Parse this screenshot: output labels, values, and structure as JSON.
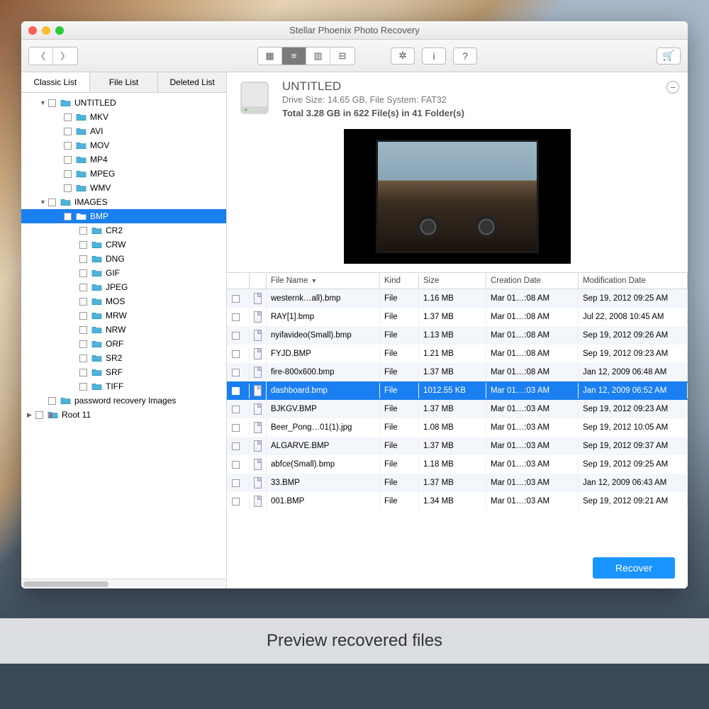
{
  "window": {
    "title": "Stellar Phoenix Photo Recovery"
  },
  "sideTabs": [
    "Classic List",
    "File List",
    "Deleted List"
  ],
  "tree": [
    {
      "level": 0,
      "label": "UNTITLED",
      "disclosure": "down",
      "kind": "folder"
    },
    {
      "level": 1,
      "label": "MKV",
      "kind": "folder"
    },
    {
      "level": 1,
      "label": "AVI",
      "kind": "folder"
    },
    {
      "level": 1,
      "label": "MOV",
      "kind": "folder"
    },
    {
      "level": 1,
      "label": "MP4",
      "kind": "folder"
    },
    {
      "level": 1,
      "label": "MPEG",
      "kind": "folder"
    },
    {
      "level": 1,
      "label": "WMV",
      "kind": "folder"
    },
    {
      "level": 0,
      "label": "IMAGES",
      "disclosure": "down",
      "kind": "folder"
    },
    {
      "level": 1,
      "label": "BMP",
      "kind": "folder",
      "selected": true
    },
    {
      "level": 2,
      "label": "CR2",
      "kind": "folder"
    },
    {
      "level": 2,
      "label": "CRW",
      "kind": "folder"
    },
    {
      "level": 2,
      "label": "DNG",
      "kind": "folder"
    },
    {
      "level": 2,
      "label": "GIF",
      "kind": "folder"
    },
    {
      "level": 2,
      "label": "JPEG",
      "kind": "folder"
    },
    {
      "level": 2,
      "label": "MOS",
      "kind": "folder"
    },
    {
      "level": 2,
      "label": "MRW",
      "kind": "folder"
    },
    {
      "level": 2,
      "label": "NRW",
      "kind": "folder"
    },
    {
      "level": 2,
      "label": "ORF",
      "kind": "folder"
    },
    {
      "level": 2,
      "label": "SR2",
      "kind": "folder"
    },
    {
      "level": 2,
      "label": "SRF",
      "kind": "folder"
    },
    {
      "level": 2,
      "label": "TIFF",
      "kind": "folder"
    },
    {
      "level": 0,
      "label": "password recovery Images",
      "kind": "folder"
    },
    {
      "level": 0,
      "label": "Root 11",
      "kind": "folder-x",
      "disclosure": "right",
      "leftDisclosure": true
    }
  ],
  "drive": {
    "name": "UNTITLED",
    "sub": "Drive Size: 14.65 GB, File System: FAT32",
    "total": "Total 3.28 GB in 622 File(s) in 41 Folder(s)"
  },
  "columns": {
    "name": "File Name",
    "kind": "Kind",
    "size": "Size",
    "cd": "Creation Date",
    "md": "Modification Date"
  },
  "files": [
    {
      "name": "westernk…all).bmp",
      "kind": "File",
      "size": "1.16 MB",
      "cd": "Mar 01…:08 AM",
      "md": "Sep 19, 2012 09:25 AM"
    },
    {
      "name": "RAY[1].bmp",
      "kind": "File",
      "size": "1.37 MB",
      "cd": "Mar 01…:08 AM",
      "md": "Jul 22, 2008 10:45 AM"
    },
    {
      "name": "nyifavideo(Small).bmp",
      "kind": "File",
      "size": "1.13 MB",
      "cd": "Mar 01…:08 AM",
      "md": "Sep 19, 2012 09:26 AM"
    },
    {
      "name": "FYJD.BMP",
      "kind": "File",
      "size": "1.21 MB",
      "cd": "Mar 01…:08 AM",
      "md": "Sep 19, 2012 09:23 AM"
    },
    {
      "name": "fire-800x600.bmp",
      "kind": "File",
      "size": "1.37 MB",
      "cd": "Mar 01…:08 AM",
      "md": "Jan 12, 2009 06:48 AM"
    },
    {
      "name": "dashboard.bmp",
      "kind": "File",
      "size": "1012.55 KB",
      "cd": "Mar 01…:03 AM",
      "md": "Jan 12, 2009 06:52 AM",
      "selected": true
    },
    {
      "name": "BJKGV.BMP",
      "kind": "File",
      "size": "1.37 MB",
      "cd": "Mar 01…:03 AM",
      "md": "Sep 19, 2012 09:23 AM"
    },
    {
      "name": "Beer_Pong…01(1).jpg",
      "kind": "File",
      "size": "1.08 MB",
      "cd": "Mar 01…:03 AM",
      "md": "Sep 19, 2012 10:05 AM"
    },
    {
      "name": "ALGARVE.BMP",
      "kind": "File",
      "size": "1.37 MB",
      "cd": "Mar 01…:03 AM",
      "md": "Sep 19, 2012 09:37 AM"
    },
    {
      "name": "abfce(Small).bmp",
      "kind": "File",
      "size": "1.18 MB",
      "cd": "Mar 01…:03 AM",
      "md": "Sep 19, 2012 09:25 AM"
    },
    {
      "name": "33.BMP",
      "kind": "File",
      "size": "1.37 MB",
      "cd": "Mar 01…:03 AM",
      "md": "Jan 12, 2009 06:43 AM"
    },
    {
      "name": "001.BMP",
      "kind": "File",
      "size": "1.34 MB",
      "cd": "Mar 01…:03 AM",
      "md": "Sep 19, 2012 09:21 AM"
    }
  ],
  "recoverLabel": "Recover",
  "caption": "Preview recovered files"
}
